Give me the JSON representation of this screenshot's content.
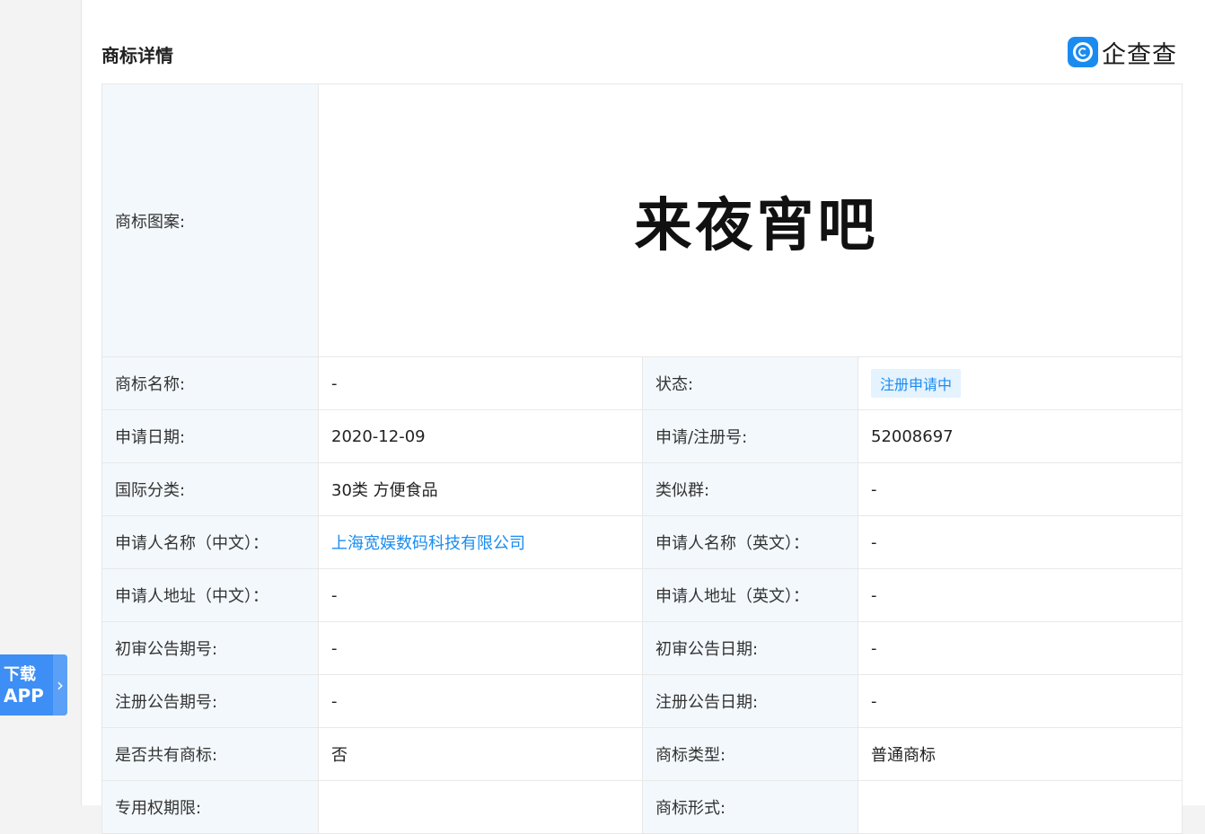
{
  "section": {
    "title": "商标详情"
  },
  "brand": {
    "name": "企查查",
    "icon": "qcc-logo-icon",
    "color": "#1a8cf0"
  },
  "trademark_image": {
    "label": "商标图案:",
    "text": "来夜宵吧"
  },
  "rows": [
    {
      "l1": "商标名称:",
      "v1": "-",
      "l2": "状态:",
      "v2": "注册申请中"
    },
    {
      "l1": "申请日期:",
      "v1": "2020-12-09",
      "l2": "申请/注册号:",
      "v2": "52008697"
    },
    {
      "l1": "国际分类:",
      "v1": "30类 方便食品",
      "l2": "类似群:",
      "v2": "-"
    },
    {
      "l1": "申请人名称（中文）：",
      "v1": "上海宽娱数码科技有限公司",
      "l2": "申请人名称（英文）：",
      "v2": "-"
    },
    {
      "l1": "申请人地址（中文）：",
      "v1": "-",
      "l2": "申请人地址（英文）：",
      "v2": "-"
    },
    {
      "l1": "初审公告期号:",
      "v1": "-",
      "l2": "初审公告日期:",
      "v2": "-"
    },
    {
      "l1": "注册公告期号:",
      "v1": "-",
      "l2": "注册公告日期:",
      "v2": "-"
    },
    {
      "l1": "是否共有商标:",
      "v1": "否",
      "l2": "商标类型:",
      "v2": "普通商标"
    },
    {
      "l1": "专用权期限:",
      "v1": "",
      "l2": "商标形式:",
      "v2": ""
    }
  ],
  "download_app": {
    "line1": "下载",
    "line2": "APP",
    "chevron": "›"
  }
}
